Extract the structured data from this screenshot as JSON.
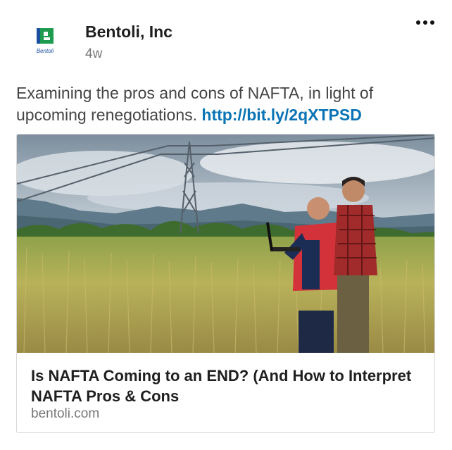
{
  "post": {
    "author": {
      "name": "Bentoli, Inc",
      "logo_text": "Bentoli",
      "logo_icon": "bentoli-logo"
    },
    "timestamp": "4w",
    "more_icon": "ellipsis-icon",
    "text": "Examining the pros and cons of NAFTA, in light of upcoming renegotiations.",
    "link": "http://bit.ly/2qXTPSD"
  },
  "card": {
    "image_description": "two men with a laptop in a wheat field under power lines",
    "title": "Is NAFTA Coming to an END? (And How to Interpret NAFTA Pros & Cons",
    "domain": "bentoli.com"
  },
  "colors": {
    "link": "#0a74b5",
    "brand_green": "#1e9b4e",
    "brand_blue": "#1a4fa0"
  }
}
